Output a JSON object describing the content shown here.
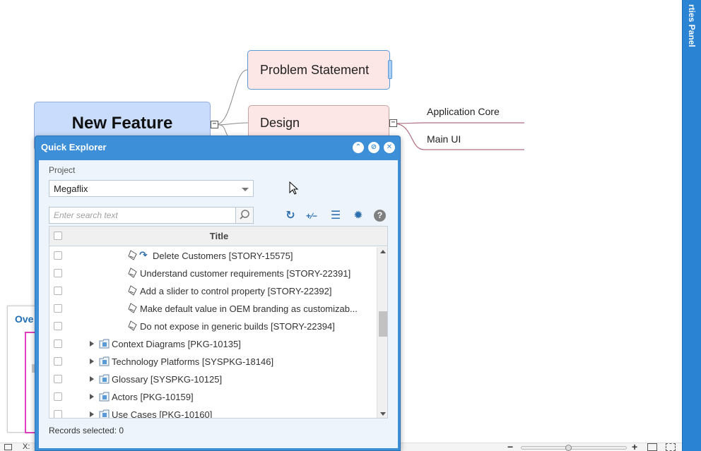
{
  "mindmap": {
    "root_label": "New Feature",
    "node_problem": "Problem Statement",
    "node_design": "Design",
    "leaf_app_core": "Application Core",
    "leaf_main_ui": "Main UI",
    "collapse_symbol": "−"
  },
  "properties_panel": {
    "title": "rties Panel"
  },
  "overview_panel": {
    "tab_label": "Ove"
  },
  "status_bar": {
    "x_label": "X:",
    "zoom_minus": "−",
    "zoom_plus": "+",
    "zoom_level": 0.44
  },
  "quick_explorer": {
    "title": "Quick Explorer",
    "header_buttons": [
      "⌃",
      "⊘",
      "✕"
    ],
    "project_label": "Project",
    "project_value": "Megaflix",
    "search_placeholder": "Enter search text",
    "toolbar_icons": [
      "refresh-icon",
      "expand-collapse-icon",
      "list-icon",
      "gear-icon",
      "help-icon"
    ],
    "toolbar_glyphs": [
      "↻",
      "+∕−",
      "☰",
      "✹",
      "?"
    ],
    "grid_header": "Title",
    "rows": [
      {
        "type": "story",
        "label": "Delete Customers [STORY-15575]",
        "has_arrow": true
      },
      {
        "type": "story",
        "label": "Understand customer requirements [STORY-22391]"
      },
      {
        "type": "story",
        "label": "Add a slider to control property [STORY-22392]"
      },
      {
        "type": "story",
        "label": "Make default value in OEM branding as customizab..."
      },
      {
        "type": "story",
        "label": "Do not expose in generic builds [STORY-22394]"
      },
      {
        "type": "pkg",
        "label": "Context Diagrams [PKG-10135]"
      },
      {
        "type": "pkg",
        "label": "Technology Platforms [SYSPKG-18146]"
      },
      {
        "type": "pkg",
        "label": "Glossary [SYSPKG-10125]"
      },
      {
        "type": "pkg",
        "label": "Actors [PKG-10159]"
      },
      {
        "type": "pkg",
        "label": "Use Cases [PKG-10160]"
      }
    ],
    "records_label": "Records selected:",
    "records_count": "0"
  },
  "colors": {
    "dialog_blue": "#3d8fd8",
    "panel_blue": "#2b83d3",
    "root_fill": "#c9dcfb",
    "node_fill": "#fde6e6",
    "link_color": "#b07080"
  }
}
